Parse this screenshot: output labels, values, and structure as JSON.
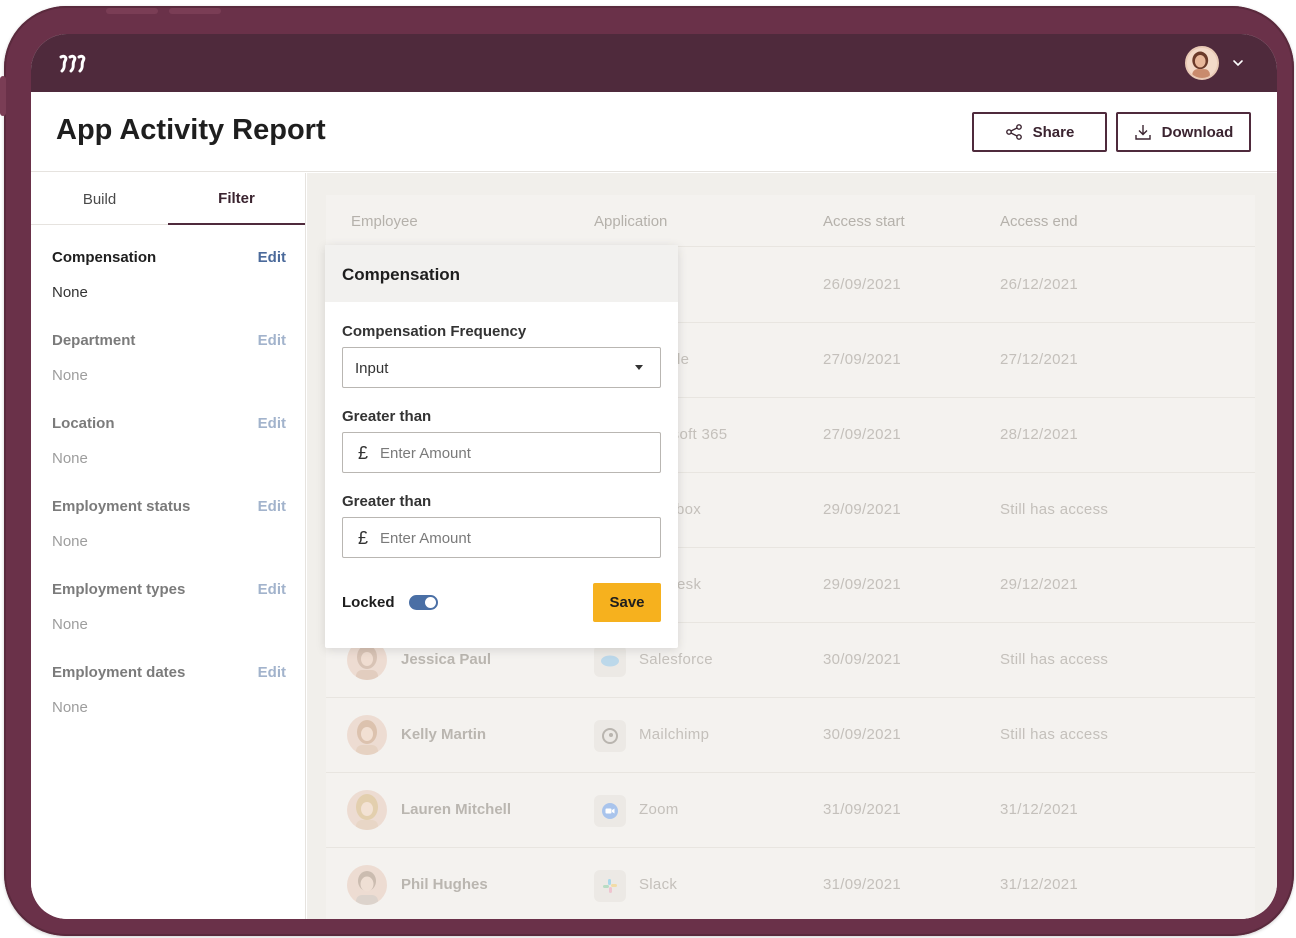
{
  "app": {
    "title": "App Activity Report"
  },
  "header": {
    "share_label": "Share",
    "download_label": "Download"
  },
  "sidebar": {
    "tabs": [
      {
        "label": "Build"
      },
      {
        "label": "Filter"
      }
    ],
    "filters": [
      {
        "label": "Compensation",
        "edit": "Edit",
        "value": "None"
      },
      {
        "label": "Department",
        "edit": "Edit",
        "value": "None"
      },
      {
        "label": "Location",
        "edit": "Edit",
        "value": "None"
      },
      {
        "label": "Employment status",
        "edit": "Edit",
        "value": "None"
      },
      {
        "label": "Employment types",
        "edit": "Edit",
        "value": "None"
      },
      {
        "label": "Employment dates",
        "edit": "Edit",
        "value": "None"
      }
    ]
  },
  "table": {
    "columns": [
      "Employee",
      "Application",
      "Access start",
      "Access end"
    ],
    "rows": [
      {
        "employee": "",
        "application": "",
        "start": "26/09/2021",
        "end": "26/12/2021"
      },
      {
        "employee": "",
        "application": "le",
        "start": "27/09/2021",
        "end": "27/12/2021"
      },
      {
        "employee": "",
        "application": "osoft 365",
        "start": "27/09/2021",
        "end": "28/12/2021"
      },
      {
        "employee": "",
        "application": "box",
        "start": "29/09/2021",
        "end": "Still has access"
      },
      {
        "employee": "",
        "application": "esk",
        "start": "29/09/2021",
        "end": "29/12/2021"
      },
      {
        "employee": "Jessica Paul",
        "application": "Salesforce",
        "start": "30/09/2021",
        "end": "Still has access"
      },
      {
        "employee": "Kelly Martin",
        "application": "Mailchimp",
        "start": "30/09/2021",
        "end": "Still has access"
      },
      {
        "employee": "Lauren Mitchell",
        "application": "Zoom",
        "start": "31/09/2021",
        "end": "31/12/2021"
      },
      {
        "employee": "Phil Hughes",
        "application": "Slack",
        "start": "31/09/2021",
        "end": "31/12/2021"
      }
    ]
  },
  "popover": {
    "title": "Compensation",
    "frequency_label": "Compensation Frequency",
    "frequency_value": "Input",
    "greater1_label": "Greater than",
    "greater1_placeholder": "Enter Amount",
    "greater2_label": "Greater than",
    "greater2_placeholder": "Enter Amount",
    "currency_symbol": "£",
    "locked_label": "Locked",
    "locked": true,
    "save_label": "Save"
  },
  "colors": {
    "brand": "#4f2a3c",
    "accent": "#f6b11e",
    "link": "#4b6a9b",
    "toggle": "#4a6fa5"
  }
}
